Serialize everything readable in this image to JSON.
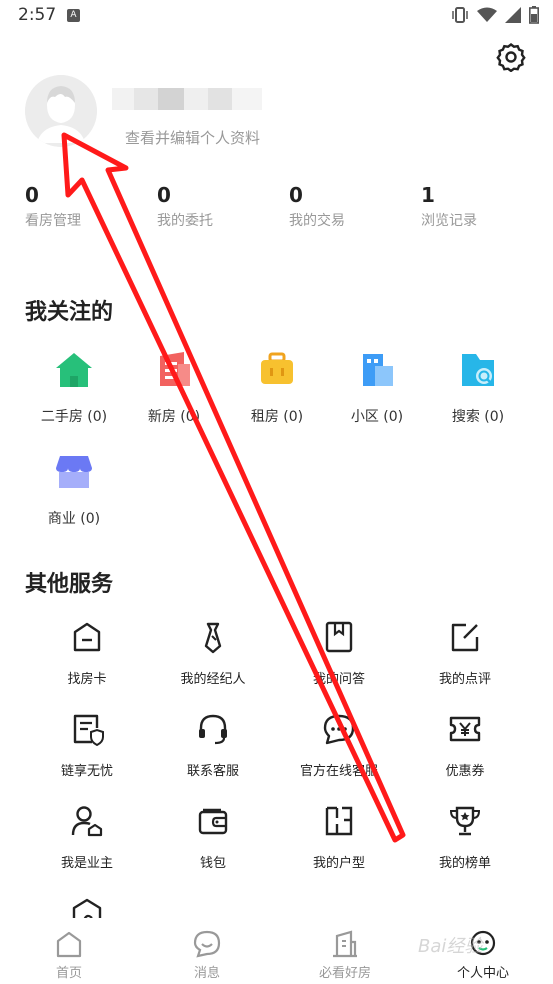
{
  "status_bar": {
    "time": "2:57",
    "notif_letter": "A"
  },
  "profile": {
    "subtitle": "查看并编辑个人资料"
  },
  "stats": [
    {
      "value": "0",
      "label": "看房管理"
    },
    {
      "value": "0",
      "label": "我的委托"
    },
    {
      "value": "0",
      "label": "我的交易"
    },
    {
      "value": "1",
      "label": "浏览记录"
    }
  ],
  "follow": {
    "title": "我关注的",
    "items": [
      {
        "label": "二手房 (0)",
        "icon": "house-icon",
        "color": "#27c07a"
      },
      {
        "label": "新房 (0)",
        "icon": "building-icon",
        "color": "#f2625f"
      },
      {
        "label": "租房 (0)",
        "icon": "suitcase-icon",
        "color": "#f7c12f"
      },
      {
        "label": "小区 (0)",
        "icon": "community-icon",
        "color": "#3d9cf6"
      },
      {
        "label": "搜索 (0)",
        "icon": "search-folder-icon",
        "color": "#27b6e8"
      },
      {
        "label": "商业 (0)",
        "icon": "store-icon",
        "color": "#6b79f4"
      }
    ]
  },
  "services": {
    "title": "其他服务",
    "items": [
      {
        "label": "找房卡",
        "icon": "house-card-icon"
      },
      {
        "label": "我的经纪人",
        "icon": "tie-icon"
      },
      {
        "label": "我的问答",
        "icon": "qa-book-icon"
      },
      {
        "label": "我的点评",
        "icon": "edit-icon"
      },
      {
        "label": "链享无忧",
        "icon": "shield-doc-icon"
      },
      {
        "label": "联系客服",
        "icon": "headset-icon"
      },
      {
        "label": "官方在线客服",
        "icon": "chat-icon"
      },
      {
        "label": "优惠券",
        "icon": "coupon-icon"
      },
      {
        "label": "我是业主",
        "icon": "owner-icon"
      },
      {
        "label": "钱包",
        "icon": "wallet-icon"
      },
      {
        "label": "我的户型",
        "icon": "floorplan-icon"
      },
      {
        "label": "我的榜单",
        "icon": "trophy-icon"
      }
    ]
  },
  "tabbar": [
    {
      "label": "首页",
      "icon": "home-tab-icon"
    },
    {
      "label": "消息",
      "icon": "message-tab-icon"
    },
    {
      "label": "必看好房",
      "icon": "good-house-tab-icon"
    },
    {
      "label": "个人中心",
      "icon": "profile-tab-icon",
      "active": true
    }
  ],
  "accent_annotation_color": "#ff1a1a",
  "watermark": "Bai经验"
}
